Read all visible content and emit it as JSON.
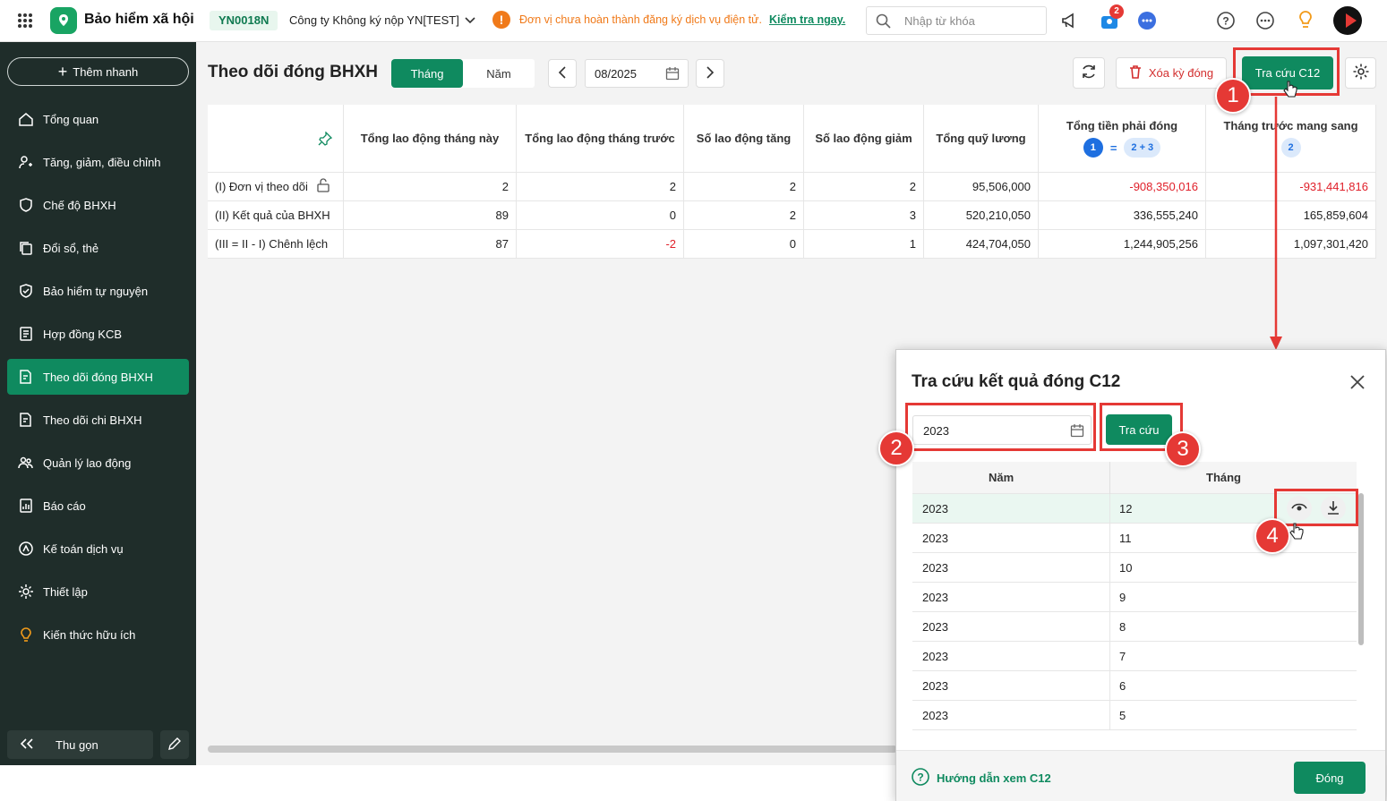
{
  "app": {
    "title": "Bảo hiểm xã hội",
    "unit_code": "YN0018N",
    "company": "Công ty Không ký nộp YN[TEST]",
    "warning": "Đơn vị chưa hoàn thành đăng ký dịch vụ điện tử.",
    "warning_link": "Kiểm tra ngay.",
    "search_placeholder": "Nhập từ khóa",
    "cart_badge": "2"
  },
  "sidebar": {
    "quick_add": "Thêm nhanh",
    "items": [
      {
        "label": "Tổng quan",
        "icon": "home-icon"
      },
      {
        "label": "Tăng, giảm, điều chỉnh",
        "icon": "user-adjust-icon"
      },
      {
        "label": "Chế độ BHXH",
        "icon": "shield-hand-icon"
      },
      {
        "label": "Đổi sổ, thẻ",
        "icon": "copy-icon"
      },
      {
        "label": "Bảo hiểm tự nguyện",
        "icon": "shield-icon"
      },
      {
        "label": "Hợp đồng KCB",
        "icon": "contract-icon"
      },
      {
        "label": "Theo dõi đóng BHXH",
        "icon": "doc-track-icon"
      },
      {
        "label": "Theo dõi chi BHXH",
        "icon": "doc-track-icon"
      },
      {
        "label": "Quản lý lao động",
        "icon": "users-icon"
      },
      {
        "label": "Báo cáo",
        "icon": "report-icon"
      },
      {
        "label": "Kế toán dịch vụ",
        "icon": "accounting-icon"
      },
      {
        "label": "Thiết lập",
        "icon": "gear-icon"
      },
      {
        "label": "Kiến thức hữu ích",
        "icon": "bulb-icon"
      }
    ],
    "collapse": "Thu gọn"
  },
  "page": {
    "title": "Theo dõi đóng BHXH",
    "tab_month": "Tháng",
    "tab_year": "Năm",
    "period": "08/2025",
    "delete_btn": "Xóa kỳ đóng",
    "lookup_btn": "Tra cứu C12"
  },
  "table": {
    "headers": [
      "Tổng lao động tháng này",
      "Tổng lao động tháng trước",
      "Số lao động tăng",
      "Số lao động giảm",
      "Tổng quỹ lương",
      "Tổng tiền phải đóng",
      "Tháng trước mang sang"
    ],
    "formula": {
      "a": "1",
      "eq": "=",
      "b": "2 + 3",
      "c": "2"
    },
    "rows": [
      {
        "label": "(I) Đơn vị theo dõi",
        "values": [
          "2",
          "2",
          "2",
          "2",
          "95,506,000",
          "-908,350,016",
          "-931,441,816"
        ]
      },
      {
        "label": "(II) Kết quả của BHXH",
        "values": [
          "89",
          "0",
          "2",
          "3",
          "520,210,050",
          "336,555,240",
          "165,859,604"
        ]
      },
      {
        "label": "(III = II - I) Chênh lệch",
        "values": [
          "87",
          "-2",
          "0",
          "1",
          "424,704,050",
          "1,244,905,256",
          "1,097,301,420"
        ]
      }
    ]
  },
  "modal": {
    "title": "Tra cứu kết quả đóng C12",
    "year": "2023",
    "search_btn": "Tra cứu",
    "col_year": "Năm",
    "col_month": "Tháng",
    "rows": [
      {
        "y": "2023",
        "m": "12"
      },
      {
        "y": "2023",
        "m": "11"
      },
      {
        "y": "2023",
        "m": "10"
      },
      {
        "y": "2023",
        "m": "9"
      },
      {
        "y": "2023",
        "m": "8"
      },
      {
        "y": "2023",
        "m": "7"
      },
      {
        "y": "2023",
        "m": "6"
      },
      {
        "y": "2023",
        "m": "5"
      }
    ],
    "help": "Hướng dẫn xem C12",
    "close_btn": "Đóng"
  },
  "callouts": [
    "1",
    "2",
    "3",
    "4"
  ]
}
